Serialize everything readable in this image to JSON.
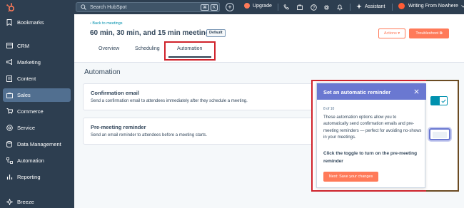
{
  "sidebar": {
    "items": [
      {
        "label": "Bookmarks",
        "icon": "bookmark-icon"
      },
      {
        "label": "CRM",
        "icon": "crm-icon"
      },
      {
        "label": "Marketing",
        "icon": "marketing-icon"
      },
      {
        "label": "Content",
        "icon": "content-icon"
      },
      {
        "label": "Sales",
        "icon": "sales-icon",
        "active": true
      },
      {
        "label": "Commerce",
        "icon": "commerce-icon"
      },
      {
        "label": "Service",
        "icon": "service-icon"
      },
      {
        "label": "Data Management",
        "icon": "database-icon"
      },
      {
        "label": "Automation",
        "icon": "automation-icon"
      },
      {
        "label": "Reporting",
        "icon": "reporting-icon"
      },
      {
        "label": "Breeze",
        "icon": "breeze-icon"
      }
    ]
  },
  "topbar": {
    "search_placeholder": "Search HubSpot",
    "shortcut_keys": [
      "⌘",
      "K"
    ],
    "upgrade_label": "Upgrade",
    "assistant_label": "Assistant",
    "account_name": "Writing From Nowhere"
  },
  "header": {
    "back_link": "‹ Back to meetings",
    "title": "60 min, 30 min, and 15 min meeting",
    "badge": "Default",
    "actions_button": "Actions ▾",
    "troubleshoot_button": "Troubleshoot ⧉"
  },
  "tabs": [
    {
      "label": "Overview"
    },
    {
      "label": "Scheduling"
    },
    {
      "label": "Automation",
      "selected": true
    }
  ],
  "main": {
    "section_title": "Automation",
    "cards": [
      {
        "title": "Confirmation email",
        "description": "Send a confirmation email to attendees immediately after they schedule a meeting.",
        "enabled": true
      },
      {
        "title": "Pre-meeting reminder",
        "description": "Send an email reminder to attendees before a meeting starts.",
        "enabled": false
      }
    ]
  },
  "popover": {
    "title": "Set an automatic reminder",
    "step": "8 of 10",
    "body": "These automation options allow you to automatically send confirmation emails and pre-meeting reminders — perfect for avoiding no-shows in your meetings.",
    "cta": "Click the toggle to turn on the pre-meeting reminder",
    "next_button": "Next: Save your changes"
  },
  "colors": {
    "nav_bg": "#2d3e50",
    "accent_orange": "#ff7a59",
    "popover_header": "#6a78d1",
    "highlight_red": "#d0232b",
    "toggle_teal": "#0091ae"
  }
}
